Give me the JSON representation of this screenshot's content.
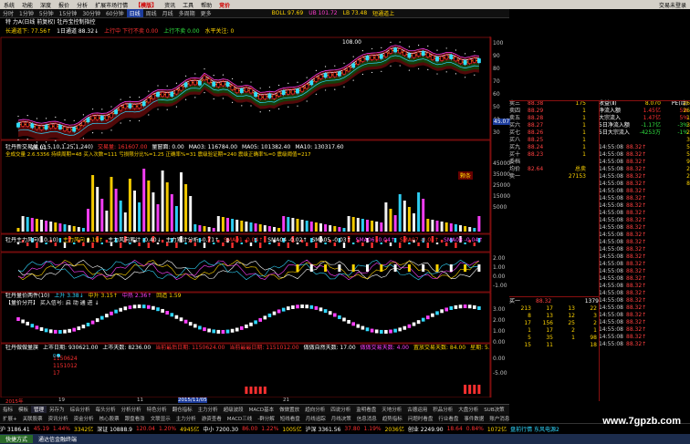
{
  "menu": {
    "items": [
      "系统",
      "功能",
      "深度",
      "报价",
      "分析",
      "扩展市场行情",
      "【模版】",
      "资讯",
      "工具",
      "帮助",
      "竞价"
    ],
    "right_label": "交易未登录"
  },
  "timeframes": {
    "items": [
      "分时",
      "1分钟",
      "5分钟",
      "15分钟",
      "30分钟",
      "60分钟",
      "日线",
      "周线",
      "月线",
      "多周期",
      "更多"
    ],
    "selected": "日线",
    "stats": [
      "BOLL 97.69",
      "UB 101.72",
      "LB 73.48"
    ],
    "stats_right": "短通道上"
  },
  "header": {
    "line1": "特 力A(日线 前复权) 牡丹宝控制指控",
    "line2_parts": [
      "长通道下: 77.56↑",
      "1日通道 88.32↓",
      "上行中 下行不卖 0.00",
      "上行不卖 0.00",
      "水平关注: 0"
    ]
  },
  "main_chart": {
    "price_labels": [
      "108.00"
    ],
    "low_label": "26.01",
    "y_axis": [
      "100",
      "90",
      "80",
      "70",
      "60",
      "50",
      "40",
      "30"
    ],
    "current_price": "45.07"
  },
  "vol_panel": {
    "title_parts": [
      "牡丹新交易量 (3.5,10,1.25,1,240)",
      "交易量: 161607.00",
      "量窗面: 0.00",
      "MA03: 116784.00",
      "MA05: 101382.40",
      "MA10: 130317.60"
    ],
    "row2": "全成交量 2.6.5356  持续周期=48  买入次数=111  亏损限分比%=1.25  正确率%=31  震级验证期=240  震级正确率%=0  震级阈值=217",
    "y_axis": [
      "45000",
      "35000",
      "25000",
      "15000",
      "5000"
    ],
    "badge": "颗条"
  },
  "flow_panel": {
    "title_parts": [
      "牡丹主力风向(10,10)",
      "主力风向 0.19↑",
      "主力风向累计 -0.40↓",
      "主力累计分析 -0.71↑",
      "SMA01 -0.04↑",
      "SMA04 -0.02↑",
      "SMA05 -0.03↑",
      "SMA06 -0.04↑",
      "SMA07 -0.04↑",
      "SMA08 -0.04↑"
    ]
  },
  "macd_panel": {
    "y_axis": [
      "2.00",
      "1.00",
      "0.00",
      "-1.00"
    ]
  },
  "buy_panel": {
    "title_parts": [
      "牡丹量价两件(10)",
      "上升 3.38↓",
      "中升 3.15↑",
      "中热 2.36↑",
      "回造 1.59"
    ],
    "line2": "【量价分开】 买入信号:  启  动  通  进 ↓",
    "y_axis": [
      "3.00",
      "2.00",
      "1.00",
      "0.00"
    ]
  },
  "bottom_panel": {
    "title_parts": [
      "牡丹做做量旗",
      "上市日期: 930621.00",
      "上市天数: 8236.00",
      "当前最后日期: 1150624.00",
      "当前最最日期: 1151012.00",
      "做做自然天数: 17.00",
      "做做交易天数: 4.00",
      "置放交易天数: 84.00",
      "星期: 5.00↑"
    ],
    "values": [
      "1150624",
      "1151012",
      "17"
    ],
    "dot_value": "0",
    "y_axis": [
      "0.00",
      "-5.00"
    ]
  },
  "dates": {
    "year_left": "2015年",
    "mid": "2015/11/05",
    "items": [
      "19",
      "11",
      "21"
    ]
  },
  "order_book": {
    "asks": [
      {
        "label": "卖三",
        "price": "88.38",
        "vol": "175"
      },
      {
        "label": "卖四",
        "price": "88.29",
        "vol": "1"
      },
      {
        "label": "卖五",
        "price": "88.28",
        "vol": "1"
      },
      {
        "label": "买六",
        "price": "88.27",
        "vol": "1"
      },
      {
        "label": "买七",
        "price": "88.26",
        "vol": "1"
      },
      {
        "label": "买八",
        "price": "88.25",
        "vol": "1"
      },
      {
        "label": "买九",
        "price": "88.24",
        "vol": "1"
      },
      {
        "label": "买十",
        "price": "88.23",
        "vol": "1"
      }
    ],
    "extra": [
      {
        "label": "委档",
        "price": "",
        "vol": ""
      },
      {
        "label": "均价",
        "price": "82.64",
        "vol": "总卖"
      },
      {
        "label": "卖一",
        "price": "",
        "vol": "27153"
      }
    ]
  },
  "flow_table": [
    {
      "name": "收益(Ⅱ)",
      "v1": "8.070",
      "v2": "PE(动)",
      "v3": "1053.3"
    },
    {
      "name": "净流入额",
      "v1": "1.45亿",
      "v2": "5%",
      "v3": ""
    },
    {
      "name": "大宗流入",
      "v1": "1.47亿",
      "v2": "5%",
      "v3": ""
    },
    {
      "name": "5日净流入额",
      "v1": "-1.17亿",
      "v2": "-3%",
      "v3": ""
    },
    {
      "name": "5日大宗流入",
      "v1": "-4253万",
      "v2": "-1%",
      "v3": ""
    }
  ],
  "ticks": {
    "times": [
      "14:55:08",
      "14:55:08",
      "14:55:08",
      "14:55:08",
      "14:55:08",
      "14:55:08",
      "14:55:08",
      "14:55:08",
      "14:55:08",
      "14:55:08",
      "14:55:08",
      "14:55:08",
      "14:55:08",
      "14:55:08",
      "14:55:08",
      "14:55:08",
      "14:55:08",
      "14:55:08",
      "14:55:08",
      "14:55:08",
      "14:55:08",
      "14:55:08",
      "14:55:08",
      "14:55:08",
      "14:55:08",
      "14:55:08",
      "14:55:08",
      "14:55:08",
      "14:55:08",
      "14:55:08",
      "14:55:08",
      "14:55:08",
      "14:55:08"
    ],
    "price": "88.32↑",
    "vols": [
      "26",
      "26",
      "1",
      "3",
      "2",
      "3",
      "5",
      "5",
      "9",
      "2",
      "2",
      "8"
    ]
  },
  "lower_table": {
    "header": [
      "买一",
      "88.32",
      "1379"
    ],
    "rows": [
      [
        "213",
        "17",
        "13",
        "22"
      ],
      [
        "8",
        "13",
        "12",
        "3"
      ],
      [
        "17",
        "156",
        "25",
        "2"
      ],
      [
        "1",
        "17",
        "2",
        "1"
      ],
      [
        "5",
        "35",
        "1",
        "98"
      ],
      [
        "15",
        "11",
        "",
        "18"
      ]
    ]
  },
  "bottom_tabs": {
    "row1": [
      "指标",
      "模板",
      "管理",
      "另存为",
      "综合分析",
      "每头分析",
      "分析分析",
      "特色分析",
      "翻仓指标",
      "主力分析",
      "超级波段",
      "MACD基本",
      "做做置放",
      "趋向分析",
      "四说分析",
      "监明看盘",
      "天地分析",
      "古德运用",
      "积品分析",
      "大盘分析",
      "SUB决策",
      "SMP决策",
      "资金决策"
    ],
    "row2": [
      "扩展+",
      "关联股票",
      "资讯分析",
      "资金分析",
      "核心股票",
      "跟盘看涨",
      "文联显示",
      "主力分析",
      "游资查看",
      "MACD三线",
      "-群分解",
      "短线看盘",
      "月线追踪",
      "月线决策",
      "信息消息",
      "趋势指标",
      "问题时看盘",
      "行业看盘",
      "事件数据",
      "账户消息"
    ],
    "active": "管理"
  },
  "status_bar": {
    "items": [
      {
        "t": "沪 3186.41",
        "c": "white"
      },
      {
        "t": "45.19",
        "c": "red"
      },
      {
        "t": "1.44%",
        "c": "red"
      },
      {
        "t": "3342亿",
        "c": "yellow"
      },
      {
        "t": "深证 10888.9",
        "c": "white"
      },
      {
        "t": "120.04",
        "c": "red"
      },
      {
        "t": "1.20%",
        "c": "red"
      },
      {
        "t": "4945亿",
        "c": "yellow"
      },
      {
        "t": "中小 7200.30",
        "c": "white"
      },
      {
        "t": "86.00",
        "c": "red"
      },
      {
        "t": "1.22%",
        "c": "red"
      },
      {
        "t": "1005亿",
        "c": "yellow"
      },
      {
        "t": "沪深 3361.56",
        "c": "white"
      },
      {
        "t": "37.80",
        "c": "red"
      },
      {
        "t": "1.19%",
        "c": "red"
      },
      {
        "t": "2036亿",
        "c": "yellow"
      },
      {
        "t": "创业 2249.90",
        "c": "white"
      },
      {
        "t": "18.64",
        "c": "red"
      },
      {
        "t": "0.84%",
        "c": "red"
      },
      {
        "t": "1072亿",
        "c": "yellow"
      },
      {
        "t": "盘前行情 东风电源2",
        "c": "cyan"
      }
    ]
  },
  "taskbar": {
    "start": "快捷方式",
    "items": [
      "通达信金融终端"
    ]
  },
  "watermark": "www.7gpzb.com",
  "colors": {
    "up": "#ff3030",
    "down": "#30e0ff",
    "ma_yellow": "#ffd400",
    "band": "#5a0a0a"
  }
}
